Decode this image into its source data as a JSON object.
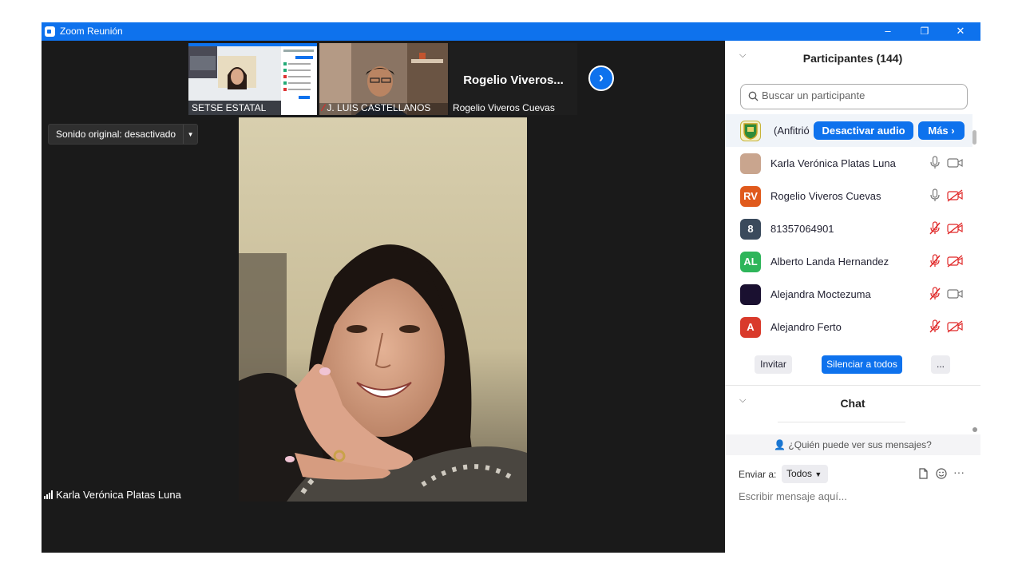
{
  "window": {
    "title": "Zoom Reunión",
    "minimize": "–",
    "restore": "❐",
    "close": "✕"
  },
  "thumbnails": [
    {
      "label": "SETSE ESTATAL"
    },
    {
      "label": "J. LUIS CASTELLANOS",
      "muted": true
    },
    {
      "label": "Rogelio Viveros Cuevas",
      "display_name": "Rogelio  Viveros..."
    }
  ],
  "next_page_icon": "chevron-right-icon",
  "sound_button": {
    "label": "Sonido original: desactivado"
  },
  "active_speaker": {
    "name": "Karla Verónica Platas Luna"
  },
  "participants_panel": {
    "title": "Participantes (144)",
    "search_placeholder": "Buscar un participante",
    "host_row": {
      "name": "(Anfitrió",
      "mute_all_audio": "Desactivar audio",
      "more": "Más"
    },
    "participants": [
      {
        "name": "Karla Verónica Platas Luna",
        "initials": "",
        "avatar_color": "#c9a58e",
        "mic": "on",
        "video": "on"
      },
      {
        "name": "Rogelio Viveros Cuevas",
        "initials": "RV",
        "avatar_color": "#e05a1c",
        "mic": "on",
        "video": "off"
      },
      {
        "name": "81357064901",
        "initials": "8",
        "avatar_color": "#3a4a5c",
        "mic": "off",
        "video": "off"
      },
      {
        "name": "Alberto Landa Hernandez",
        "initials": "AL",
        "avatar_color": "#2eb55a",
        "mic": "off",
        "video": "off"
      },
      {
        "name": "Alejandra Moctezuma",
        "initials": "",
        "avatar_color": "#1a1030",
        "mic": "off",
        "video": "on"
      },
      {
        "name": "Alejandro Ferto",
        "initials": "A",
        "avatar_color": "#d93a2b",
        "mic": "off",
        "video": "off"
      }
    ],
    "invite": "Invitar",
    "mute_all": "Silenciar a todos",
    "more_options": "..."
  },
  "chat_panel": {
    "title": "Chat",
    "who_can_see": "¿Quién puede ver sus mensajes?",
    "send_to_label": "Enviar a:",
    "send_to_value": "Todos",
    "input_placeholder": "Escribir mensaje aquí...",
    "more_tools": "···"
  },
  "colors": {
    "accent": "#0e72ed",
    "muted_red": "#e02828",
    "background": "#1a1a1a"
  }
}
